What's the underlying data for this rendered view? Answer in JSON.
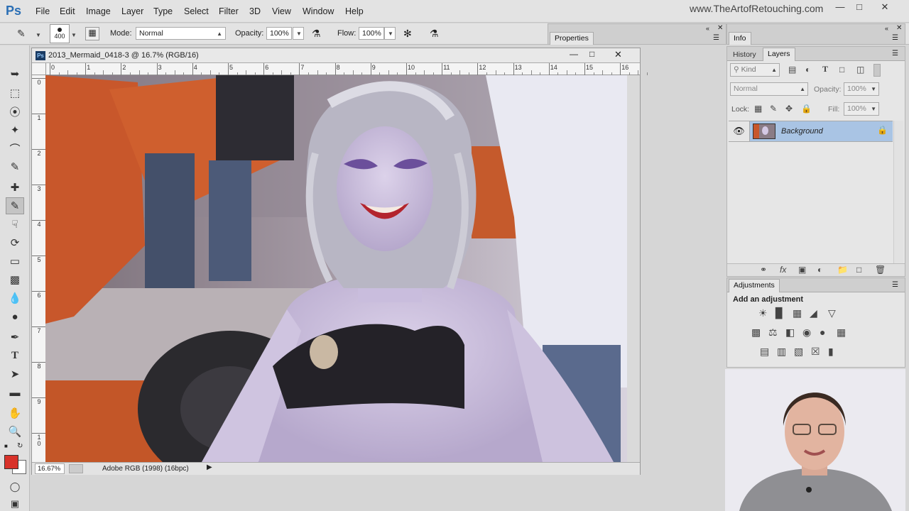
{
  "app": {
    "logo": "Ps",
    "watermark": "www.TheArtofRetouching.com"
  },
  "menu": [
    "File",
    "Edit",
    "Image",
    "Layer",
    "Type",
    "Select",
    "Filter",
    "3D",
    "View",
    "Window",
    "Help"
  ],
  "options": {
    "brush_size": "400",
    "mode_label": "Mode:",
    "mode_value": "Normal",
    "opacity_label": "Opacity:",
    "opacity_value": "100%",
    "flow_label": "Flow:",
    "flow_value": "100%"
  },
  "document": {
    "title": "2013_Mermaid_0418-3 @ 16.7% (RGB/16)",
    "zoom": "16.67%",
    "profile": "Adobe RGB (1998) (16bpc)",
    "h_ruler": [
      "0",
      "1",
      "2",
      "3",
      "4",
      "5",
      "6",
      "7",
      "8",
      "9",
      "10",
      "11",
      "12",
      "13",
      "14",
      "15",
      "16"
    ],
    "v_ruler": [
      "0",
      "1",
      "2",
      "3",
      "4",
      "5",
      "6",
      "7",
      "8",
      "9",
      "10"
    ]
  },
  "properties_panel": {
    "tab": "Properties"
  },
  "info_panel": {
    "tab": "Info"
  },
  "layers_panel": {
    "tabs": [
      "History",
      "Layers"
    ],
    "kind_label": "Kind",
    "blend_mode": "Normal",
    "opacity_label": "Opacity:",
    "opacity_value": "100%",
    "lock_label": "Lock:",
    "fill_label": "Fill:",
    "fill_value": "100%",
    "layer_name": "Background"
  },
  "adjustments_panel": {
    "tab": "Adjustments",
    "heading": "Add an adjustment"
  },
  "colors": {
    "foreground": "#d8322a",
    "background": "#ffffff",
    "selected_layer": "#a9c4e4",
    "ps_blue": "#2b6fb5"
  }
}
